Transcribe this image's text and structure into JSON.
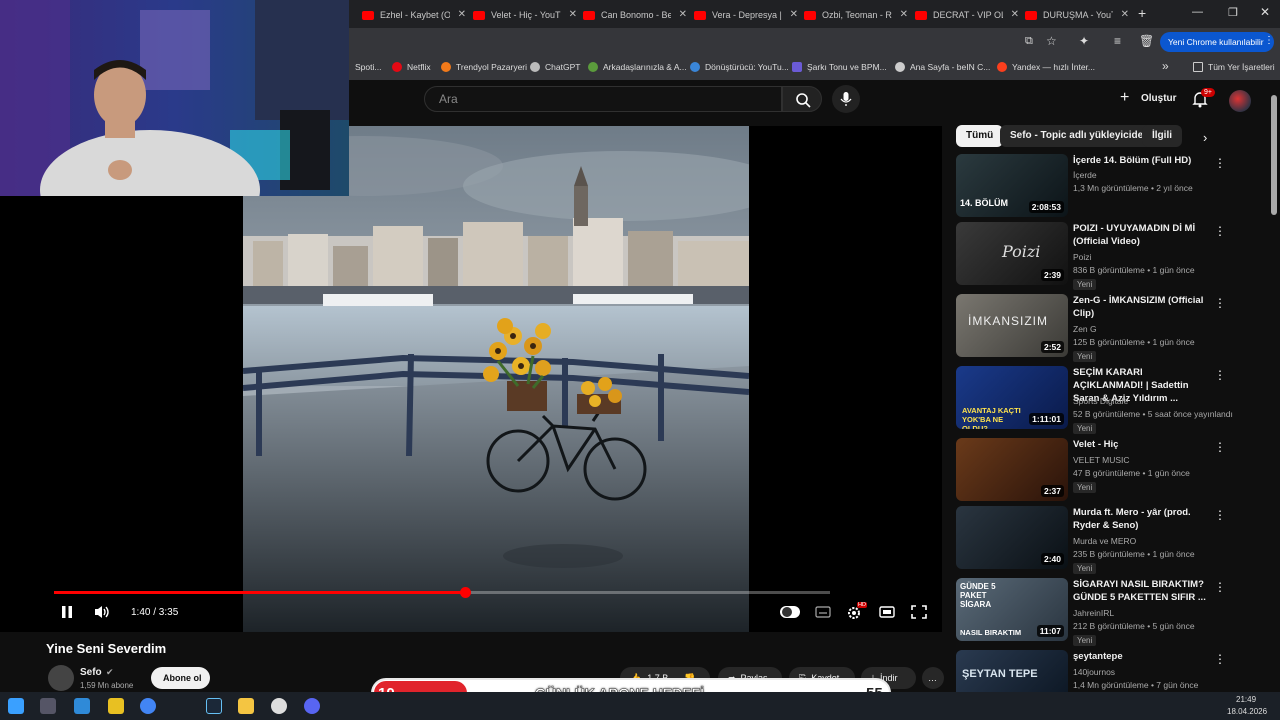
{
  "browser": {
    "tabs": [
      {
        "title": "Ezhel - Kaybet (Of"
      },
      {
        "title": "Velet - Hiç - YouT"
      },
      {
        "title": "Can Bonomo - Be"
      },
      {
        "title": "Vera - Depresya |"
      },
      {
        "title": "Ozbi, Teoman - R"
      },
      {
        "title": "DECRAT - VIP OLS"
      },
      {
        "title": "DURUŞMA - YouT"
      }
    ],
    "new_tab": "+",
    "profile_button": "Yeni Chrome kullanılabilir",
    "bookmarks": [
      {
        "label": "Spoti..."
      },
      {
        "label": "Netflix"
      },
      {
        "label": "Trendyol Pazaryeri"
      },
      {
        "label": "ChatGPT"
      },
      {
        "label": "Arkadaşlarınızla & A..."
      },
      {
        "label": "Dönüştürücü: YouTu..."
      },
      {
        "label": "Şarkı Tonu ve BPM..."
      },
      {
        "label": "Ana Sayfa - beIN C..."
      },
      {
        "label": "Yandex — hızlı İnter..."
      }
    ],
    "bookmarks_overflow": "»",
    "all_bookmarks": "Tüm Yer İşaretleri"
  },
  "youtube": {
    "search_placeholder": "Ara",
    "create_label": "Oluştur",
    "notif_count": "9+",
    "player": {
      "time": "1:40 / 3:35",
      "progress": 0.53,
      "hd_badge": "HD"
    },
    "video_title": "Yine Seni Severdim",
    "channel_name": "Sefo",
    "subscribers": "1,59 Mn abone",
    "subscribe_label": "Abone ol",
    "actions": {
      "likes": "1,7 B",
      "share": "Paylaş",
      "save": "Kaydet",
      "download": "İndir",
      "more": "…"
    },
    "chips": [
      "Tümü",
      "Sefo - Topic adlı yükleyiciden",
      "İlgili"
    ],
    "recommendations": [
      {
        "title": "İçerde 14. Bölüm (Full HD)",
        "channel": "İçerde",
        "meta": "1,3 Mn görüntüleme • 2 yıl önce",
        "duration": "2:08:53",
        "badge": ""
      },
      {
        "title": "POIZI - UYUYAMADIN Dİ Mİ (Official Video)",
        "channel": "Poizi",
        "meta": "836 B görüntüleme • 1 gün önce",
        "duration": "2:39",
        "badge": "Yeni"
      },
      {
        "title": "Zen-G - İMKANSIZIM (Official Clip)",
        "channel": "Zen G",
        "meta": "125 B görüntüleme • 1 gün önce",
        "duration": "2:52",
        "badge": "Yeni"
      },
      {
        "title": "SEÇİM KARARI AÇIKLANMADI! | Sadettin Saran & Aziz Yıldırım ...",
        "channel": "Sports Digitale",
        "meta": "52 B görüntüleme • 5 saat önce yayınlandı",
        "duration": "1:11:01",
        "badge": "Yeni"
      },
      {
        "title": "Velet - Hiç",
        "channel": "VELET MUSIC",
        "meta": "47 B görüntüleme • 1 gün önce",
        "duration": "2:37",
        "badge": "Yeni"
      },
      {
        "title": "Murda ft. Mero - yâr (prod. Ryder & Seno)",
        "channel": "Murda ve MERO",
        "meta": "235 B görüntüleme • 1 gün önce",
        "duration": "2:40",
        "badge": "Yeni"
      },
      {
        "title": "SİGARAYI NASIL BIRAKTIM? GÜNDE 5 PAKETTEN SIFIR ...",
        "channel": "JahreinIRL",
        "meta": "212 B görüntüleme • 5 gün önce",
        "duration": "11:07",
        "badge": "Yeni"
      },
      {
        "title": "şeytantepe",
        "channel": "140journos",
        "meta": "1,4 Mn görüntüleme • 7 gün önce",
        "duration": "",
        "badge": ""
      }
    ],
    "thumb_texts": {
      "icerde": "14. BÖLÜM",
      "poizi": "Poizi",
      "zeng": "İMKANSIZIM",
      "secim": "AVANTAJ KAÇTI YOK'BA NE OLDU?",
      "sigara": "GÜNDE 5 PAKET SİGARA",
      "sigara2": "NASIL BIRAKTIM",
      "seytan": "ŞEYTAN TEPE"
    }
  },
  "stream_overlay": {
    "goal_label": "GÜNLÜK ABONE HEDEFİ",
    "goal_current": "10",
    "goal_target": "55"
  },
  "taskbar": {
    "time": "21:49",
    "date": "18.04.2026"
  },
  "colors": {
    "yt_red": "#ff0000",
    "goal_red": "#e1242c",
    "background": "#0f0f0f"
  }
}
